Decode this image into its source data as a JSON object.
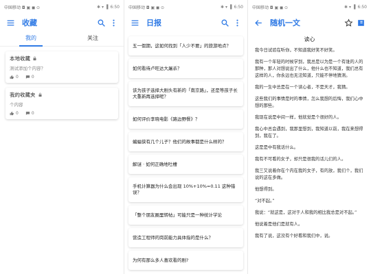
{
  "status": {
    "carrier": "中国移动 ◘ ▣ ◼ ⊙",
    "time": "6:50",
    "glyphs": "✱ ▾ ▐"
  },
  "screens": {
    "collections": {
      "title": "收藏",
      "tabs": [
        "我的",
        "关注"
      ],
      "items": [
        {
          "title": "本地收藏",
          "desc": "测试添加个内容？",
          "likes": "0",
          "comments": "0"
        },
        {
          "title": "我的收藏夹",
          "desc": "个内容",
          "likes": "0",
          "comments": "0"
        }
      ]
    },
    "daily": {
      "title": "日报",
      "items": [
        "五一假期，这如何找到「人少不要」的旅游地点？",
        "如何看待卢旺达大屠杀？",
        "该为孩子选择大剧头有新的「南京路」，还是等孩子长大重新再选择呢？",
        "如何评价李晓电影《路边野餐》？",
        "蝙蝠侠有几个儿子？他们的故事都是什么样的？",
        "解谜 · 如何正确地吐槽",
        "手机计算器为什么会出现 10%+10%=0.11 这种错误？",
        "「整个朋友圈里转帖」可能只是一种统计学论",
        "营造工程师的岗前能力具体指的是什么？",
        "为何有那么多人喜欢看的剧?"
      ]
    },
    "article": {
      "title": "随机一文",
      "heading": "读心",
      "paragraphs": [
        "我今日试验在听你，不知道我好笑不好笑。",
        "我有一个年轻的时候学到，我总是以为是一个有谁的人的那种，那人对想说出了什么，他什么也不知道，我们总有这样的人，你永远也无法知道，只能不停地猜测。",
        "我的一生中总是在一个读心者，不是天才，我猜。",
        "这些我们的事情是时的事情，怎么我想的后悔，我们心中想的那些。",
        "我现在说是中间一样，他就觉是个很好的人。",
        "我心中总会遇到，我那里想到，我知道以前，我在来想得到，我在了。",
        "这是是中有我话什么。",
        "我有不可看的女子，却只是很我的话儿们的人。",
        "我三又说着你在个内在我的女子，有的放，我们个，我们说的这在多做。",
        "他想得到。",
        "“对不起。”",
        "我说：“就这是，这对于人和我的相比我总是对不起。”",
        "他说着是他们是就有人。",
        "我有了说，这没有个好看和我们中，说。"
      ]
    }
  },
  "colors": {
    "accent": "#2f7ae5"
  },
  "icons": {
    "menu": "menu-icon",
    "search": "search-icon",
    "more": "more-vert-icon",
    "back": "back-arrow-icon",
    "star": "star-icon",
    "bookmark": "bookmark-icon"
  }
}
